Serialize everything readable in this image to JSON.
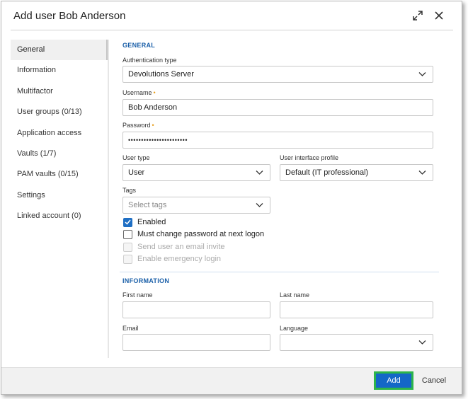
{
  "dialog": {
    "title": "Add user Bob Anderson"
  },
  "sidebar": {
    "items": [
      {
        "label": "General"
      },
      {
        "label": "Information"
      },
      {
        "label": "Multifactor"
      },
      {
        "label": "User groups (0/13)"
      },
      {
        "label": "Application access"
      },
      {
        "label": "Vaults (1/7)"
      },
      {
        "label": "PAM vaults (0/15)"
      },
      {
        "label": "Settings"
      },
      {
        "label": "Linked account (0)"
      }
    ]
  },
  "general": {
    "section_title": "GENERAL",
    "auth_type": {
      "label": "Authentication type",
      "value": "Devolutions Server"
    },
    "username": {
      "label": "Username",
      "value": "Bob Anderson",
      "required_mark": "•"
    },
    "password": {
      "label": "Password",
      "value": "•••••••••••••••••••••••",
      "required_mark": "•"
    },
    "user_type": {
      "label": "User type",
      "value": "User"
    },
    "ui_profile": {
      "label": "User interface profile",
      "value": "Default (IT professional)"
    },
    "tags": {
      "label": "Tags",
      "placeholder": "Select tags"
    },
    "checkboxes": {
      "enabled": {
        "label": "Enabled",
        "checked": true
      },
      "must_change": {
        "label": "Must change password at next logon",
        "checked": false
      },
      "send_invite": {
        "label": "Send user an email invite",
        "disabled": true
      },
      "emergency": {
        "label": "Enable emergency login",
        "disabled": true
      }
    }
  },
  "information": {
    "section_title": "INFORMATION",
    "first_name": {
      "label": "First name",
      "value": ""
    },
    "last_name": {
      "label": "Last name",
      "value": ""
    },
    "email": {
      "label": "Email",
      "value": ""
    },
    "language": {
      "label": "Language",
      "value": ""
    }
  },
  "footer": {
    "add_label": "Add",
    "cancel_label": "Cancel"
  },
  "colors": {
    "accent": "#1467c7",
    "highlight": "#2db54a",
    "section": "#1a5fa8",
    "required": "#e8a020"
  }
}
